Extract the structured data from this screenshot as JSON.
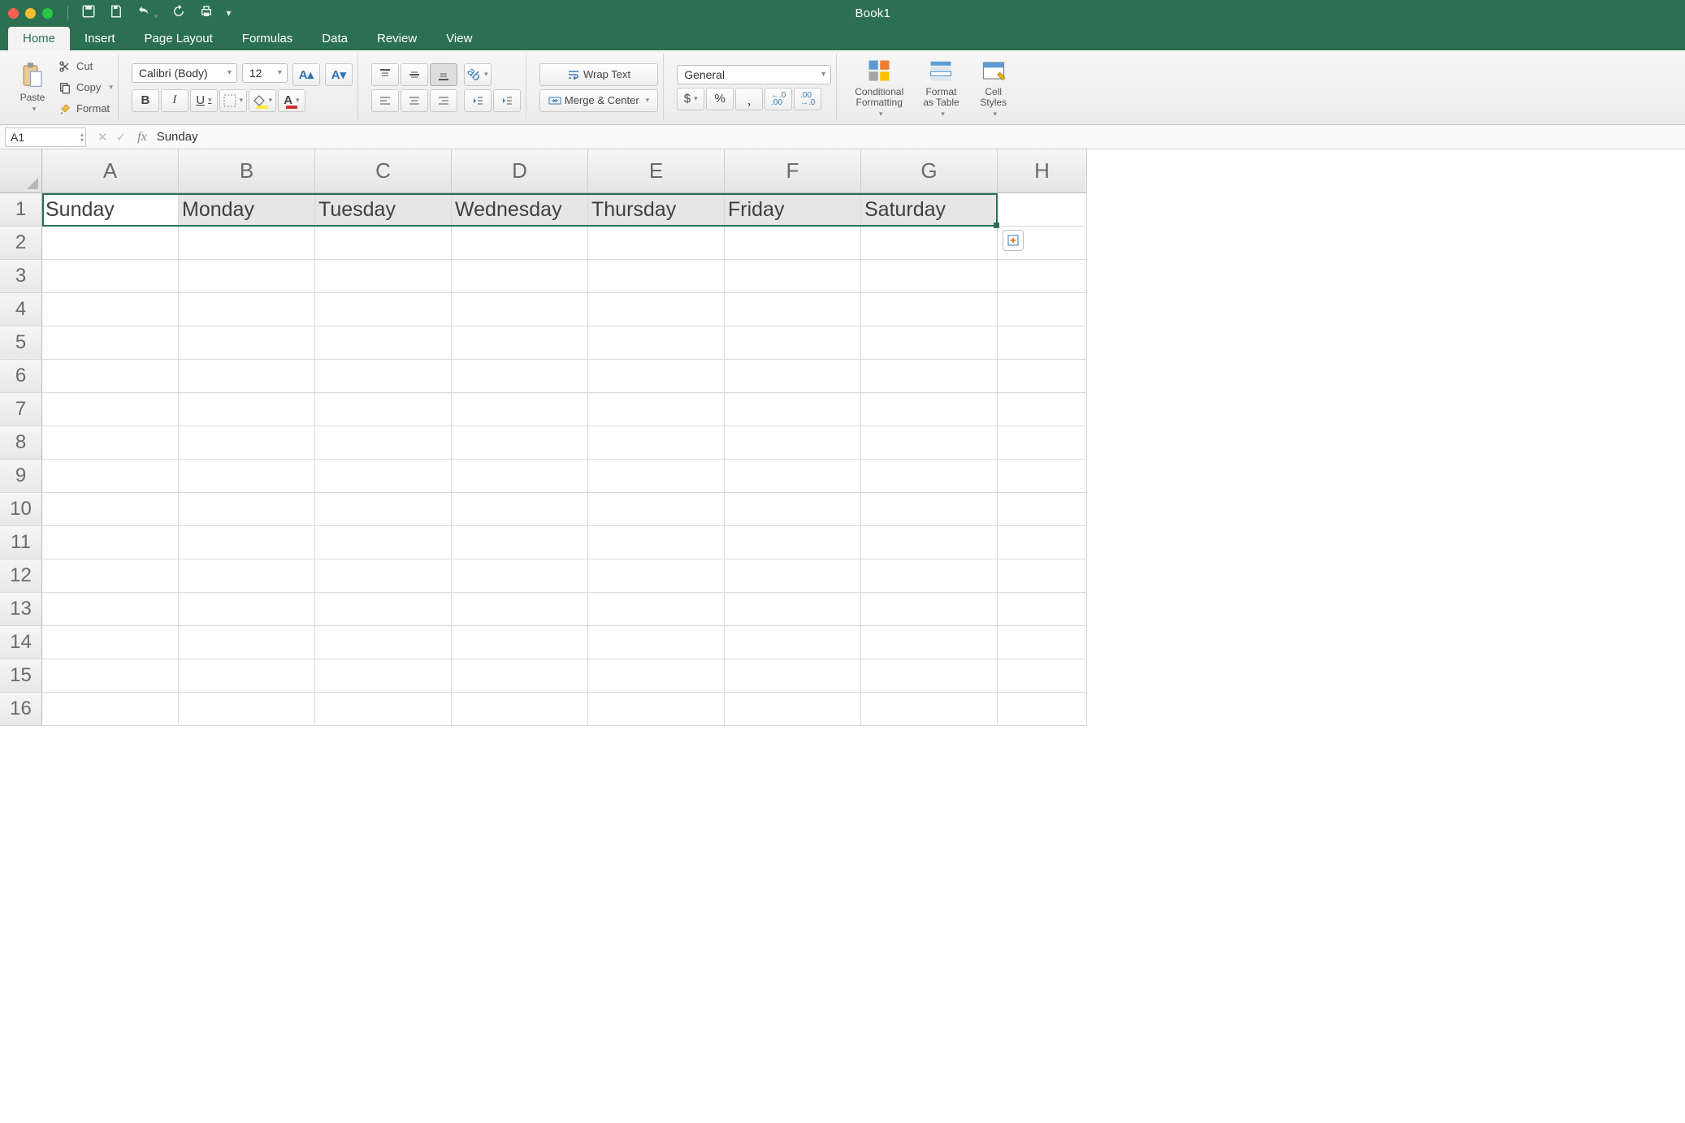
{
  "title": "Book1",
  "tabs": [
    "Home",
    "Insert",
    "Page Layout",
    "Formulas",
    "Data",
    "Review",
    "View"
  ],
  "active_tab": 0,
  "clipboard": {
    "paste": "Paste",
    "cut": "Cut",
    "copy": "Copy",
    "format": "Format"
  },
  "font": {
    "name": "Calibri (Body)",
    "size": "12"
  },
  "wrap_text": "Wrap Text",
  "merge_center": "Merge & Center",
  "number_format": "General",
  "styles": {
    "conditional_formatting": "Conditional\nFormatting",
    "format_as_table": "Format\nas Table",
    "cell_styles": "Cell\nStyles"
  },
  "namebox": "A1",
  "formula": "Sunday",
  "columns": [
    "A",
    "B",
    "C",
    "D",
    "E",
    "F",
    "G",
    "H"
  ],
  "row_count": 16,
  "data_row1": [
    "Sunday",
    "Monday",
    "Tuesday",
    "Wednesday",
    "Thursday",
    "Friday",
    "Saturday",
    ""
  ],
  "selection": {
    "row": 1,
    "col_start": 0,
    "col_end": 6
  }
}
